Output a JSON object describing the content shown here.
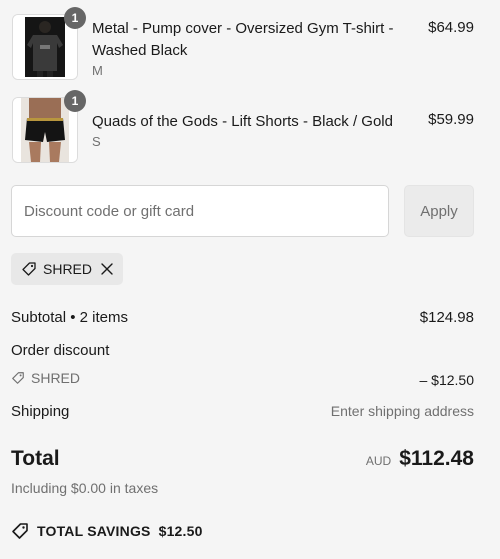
{
  "items": [
    {
      "quantity": "1",
      "title": "Metal - Pump cover - Oversized Gym T-shirt - Washed Black",
      "variant": "M",
      "price": "$64.99",
      "image_icon": "tshirt-product-image"
    },
    {
      "quantity": "1",
      "title": "Quads of the Gods - Lift Shorts - Black / Gold",
      "variant": "S",
      "price": "$59.99",
      "image_icon": "shorts-product-image"
    }
  ],
  "discount": {
    "placeholder": "Discount code or gift card",
    "value": "",
    "apply_label": "Apply",
    "applied_code": "SHRED"
  },
  "summary": {
    "subtotal_label": "Subtotal • 2 items",
    "subtotal_value": "$124.98",
    "order_discount_label": "Order discount",
    "discount_code": "SHRED",
    "discount_amount": "– $12.50",
    "shipping_label": "Shipping",
    "shipping_value": "Enter shipping address",
    "total_label": "Total",
    "currency": "AUD",
    "total_value": "$112.48",
    "taxes_note": "Including $0.00 in taxes",
    "savings_label": "TOTAL SAVINGS",
    "savings_value": "$12.50"
  },
  "colors": {
    "background": "#f5f5f5",
    "text": "#1a1a1a",
    "muted": "#707070",
    "badge": "#666666"
  }
}
